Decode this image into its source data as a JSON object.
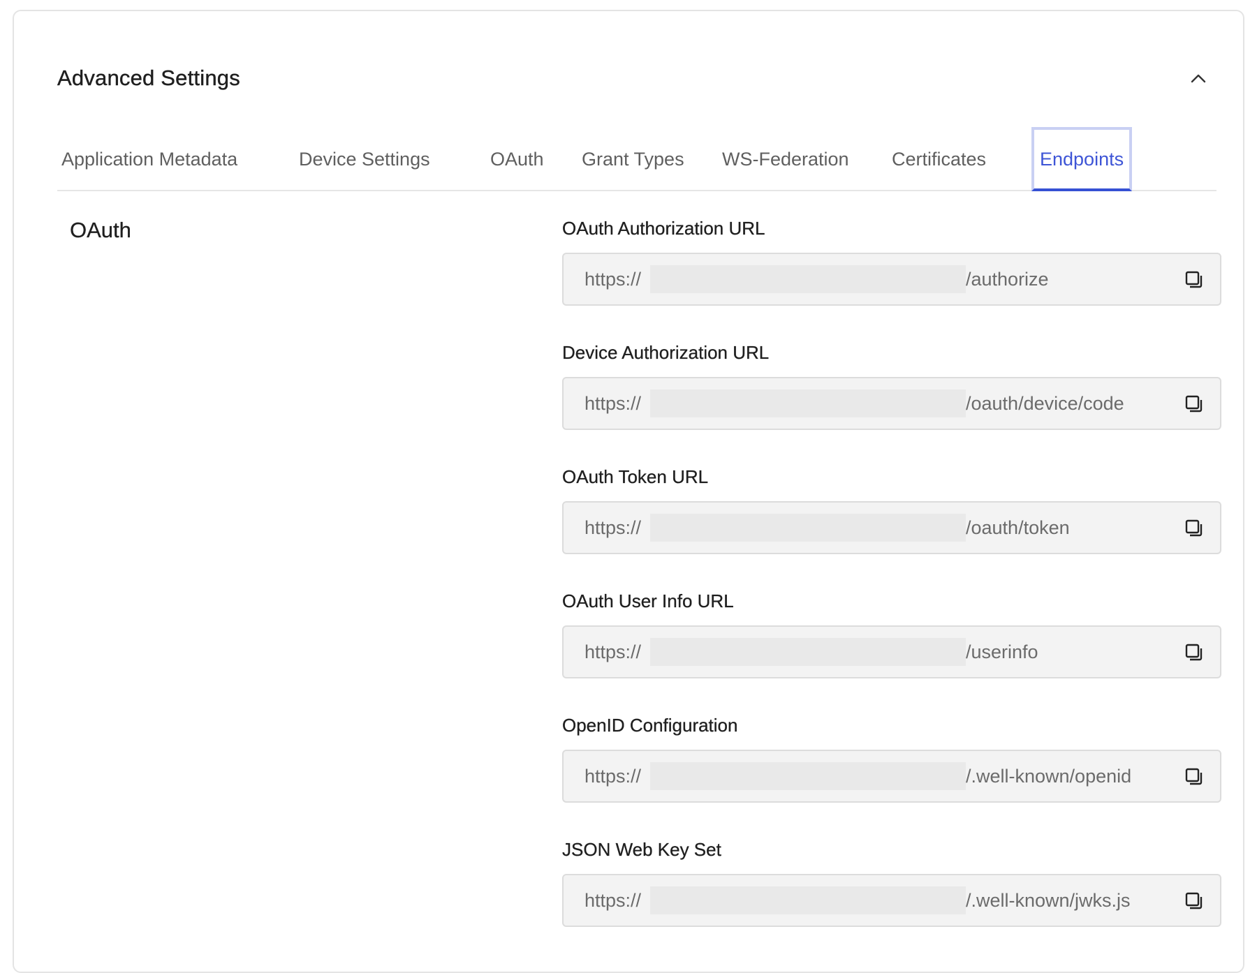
{
  "panel": {
    "title": "Advanced Settings"
  },
  "tabs": [
    {
      "label": "Application Metadata",
      "active": false
    },
    {
      "label": "Device Settings",
      "active": false
    },
    {
      "label": "OAuth",
      "active": false
    },
    {
      "label": "Grant Types",
      "active": false
    },
    {
      "label": "WS-Federation",
      "active": false
    },
    {
      "label": "Certificates",
      "active": false
    },
    {
      "label": "Endpoints",
      "active": true
    }
  ],
  "section": {
    "title": "OAuth"
  },
  "fields": [
    {
      "label": "OAuth Authorization URL",
      "prefix": "https://",
      "suffix": "/authorize"
    },
    {
      "label": "Device Authorization URL",
      "prefix": "https://",
      "suffix": "/oauth/device/code"
    },
    {
      "label": "OAuth Token URL",
      "prefix": "https://",
      "suffix": "/oauth/token"
    },
    {
      "label": "OAuth User Info URL",
      "prefix": "https://",
      "suffix": "/userinfo"
    },
    {
      "label": "OpenID Configuration",
      "prefix": "https://",
      "suffix": "/.well-known/openid"
    },
    {
      "label": "JSON Web Key Set",
      "prefix": "https://",
      "suffix": "/.well-known/jwks.js"
    }
  ],
  "icons": {
    "collapse": "chevron-up-icon",
    "copy": "copy-icon"
  },
  "colors": {
    "accent": "#3651d4",
    "accent_focus_ring": "#c9d0f3",
    "field_bg": "#f3f3f3"
  }
}
